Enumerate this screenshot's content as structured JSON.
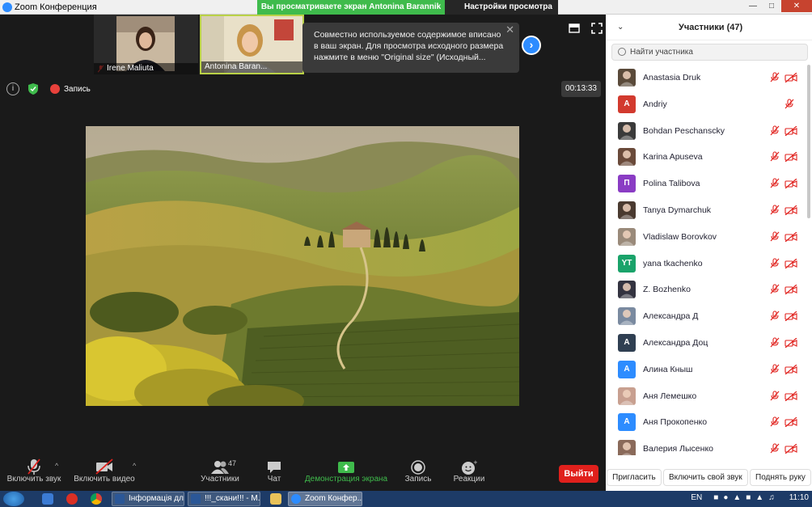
{
  "window": {
    "title": "Zoom Конференция"
  },
  "share_banner": {
    "text": "Вы просматриваете экран Antonina Barannik",
    "view_options": "Настройки просмотра"
  },
  "thumbnails": [
    {
      "name": "Irene Maliuta"
    },
    {
      "name": "Antonina Baran..."
    }
  ],
  "tooltip": {
    "text": "Совместно используемое содержимое вписано в ваш экран. Для просмотра исходного размера нажмите в меню \"Original size\" (Исходный..."
  },
  "status": {
    "recording": "Запись",
    "timer": "00:13:33"
  },
  "toolbar": {
    "mute": "Включить звук",
    "video": "Включить видео",
    "participants": "Участники",
    "participants_count": "47",
    "chat": "Чат",
    "share": "Демонстрация экрана",
    "record": "Запись",
    "reactions": "Реакции",
    "leave": "Выйти"
  },
  "panel": {
    "title": "Участники (47)",
    "search_placeholder": "Найти участника",
    "participants": [
      {
        "name": "Anastasia Druk",
        "avatar_type": "photo",
        "avatar_color": "#5a4a3a",
        "initial": "",
        "cam_off": true
      },
      {
        "name": "Andriy",
        "avatar_type": "initial",
        "avatar_color": "#d23a2e",
        "initial": "A",
        "cam_off": false
      },
      {
        "name": "Bohdan Peschanscky",
        "avatar_type": "photo",
        "avatar_color": "#3a3a3a",
        "initial": "",
        "cam_off": true
      },
      {
        "name": "Karina Apuseva",
        "avatar_type": "photo",
        "avatar_color": "#6a4a3a",
        "initial": "",
        "cam_off": true
      },
      {
        "name": "Polina Talibova",
        "avatar_type": "initial",
        "avatar_color": "#8a3cc4",
        "initial": "П",
        "cam_off": true
      },
      {
        "name": "Tanya Dymarchuk",
        "avatar_type": "photo",
        "avatar_color": "#4a3a30",
        "initial": "",
        "cam_off": true
      },
      {
        "name": "Vladislaw Borovkov",
        "avatar_type": "photo",
        "avatar_color": "#9a8a7a",
        "initial": "",
        "cam_off": true
      },
      {
        "name": "yana tkachenko",
        "avatar_type": "initial",
        "avatar_color": "#1aa36a",
        "initial": "YT",
        "cam_off": true
      },
      {
        "name": "Z. Bozhenko",
        "avatar_type": "photo",
        "avatar_color": "#333340",
        "initial": "",
        "cam_off": true
      },
      {
        "name": "Александра Д",
        "avatar_type": "photo",
        "avatar_color": "#7a8aa0",
        "initial": "",
        "cam_off": true
      },
      {
        "name": "Александра Доц",
        "avatar_type": "initial",
        "avatar_color": "#2f3f52",
        "initial": "A",
        "cam_off": true
      },
      {
        "name": "Алина Кныш",
        "avatar_type": "initial",
        "avatar_color": "#2d8cff",
        "initial": "A",
        "cam_off": true
      },
      {
        "name": "Аня Лемешко",
        "avatar_type": "photo",
        "avatar_color": "#c8a090",
        "initial": "",
        "cam_off": true
      },
      {
        "name": "Аня Прокопенко",
        "avatar_type": "initial",
        "avatar_color": "#2d8cff",
        "initial": "A",
        "cam_off": true
      },
      {
        "name": "Валерия Лысенко",
        "avatar_type": "photo",
        "avatar_color": "#8a6a5a",
        "initial": "",
        "cam_off": true
      }
    ],
    "footer": {
      "invite": "Пригласить",
      "unmute_self": "Включить свой звук",
      "raise_hand": "Поднять руку"
    }
  },
  "taskbar": {
    "tasks": [
      {
        "label": "Інформація дл..."
      },
      {
        "label": "!!!_скани!!! - М..."
      },
      {
        "label": "Zoom Конфер..."
      }
    ],
    "lang": "EN",
    "time": "11:10"
  }
}
